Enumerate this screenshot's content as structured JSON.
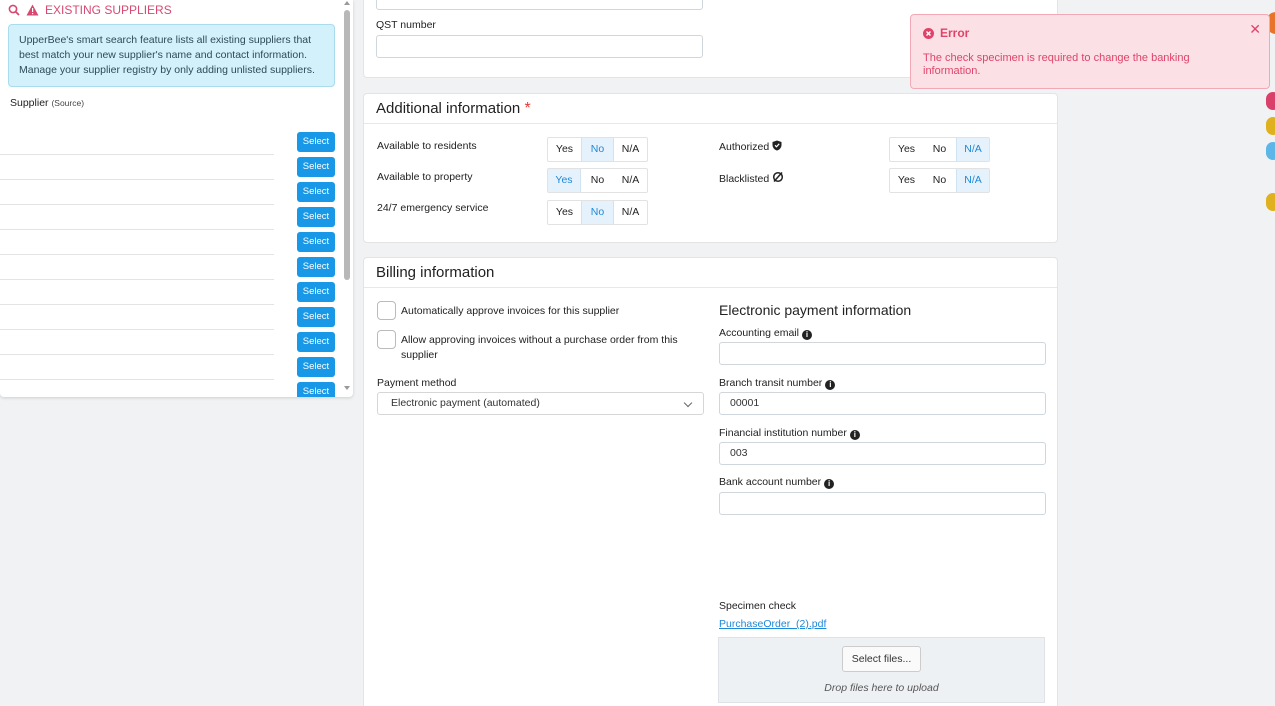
{
  "left_panel": {
    "header": "EXISTING SUPPLIERS",
    "info": "UpperBee's smart search feature lists all existing suppliers that best match your new supplier's name and contact information. Manage your supplier registry by only adding unlisted suppliers.",
    "supplier_label": "Supplier",
    "supplier_source": "(Source)",
    "select_label": "Select"
  },
  "tax": {
    "qst_label": "QST number",
    "qst_value": ""
  },
  "additional": {
    "title": "Additional information",
    "required_mark": "*",
    "available_residents": "Available to residents",
    "available_property": "Available to property",
    "emergency": "24/7 emergency service",
    "authorized": "Authorized",
    "blacklisted": "Blacklisted",
    "yes": "Yes",
    "no": "No",
    "na": "N/A"
  },
  "billing": {
    "title": "Billing information",
    "auto_approve": "Automatically approve invoices for this supplier",
    "allow_without_po": "Allow approving invoices without a purchase order from this supplier",
    "payment_method_label": "Payment method",
    "payment_method_value": "Electronic payment (automated)"
  },
  "epayment": {
    "title": "Electronic payment information",
    "accounting_email_label": "Accounting email",
    "accounting_email_value": "",
    "branch_transit_label": "Branch transit number",
    "branch_transit_value": "00001",
    "financial_institution_label": "Financial institution number",
    "financial_institution_value": "003",
    "bank_account_label": "Bank account number",
    "bank_account_value": "",
    "specimen_label": "Specimen check",
    "specimen_file": "PurchaseOrder_(2).pdf",
    "select_files": "Select files...",
    "drop_files": "Drop files here to upload"
  },
  "toast": {
    "title": "Error",
    "message": "The check specimen is required to change the banking information."
  },
  "colors": {
    "accent": "#1898e6",
    "error": "#e0436a",
    "warning_header": "#d64a71"
  }
}
